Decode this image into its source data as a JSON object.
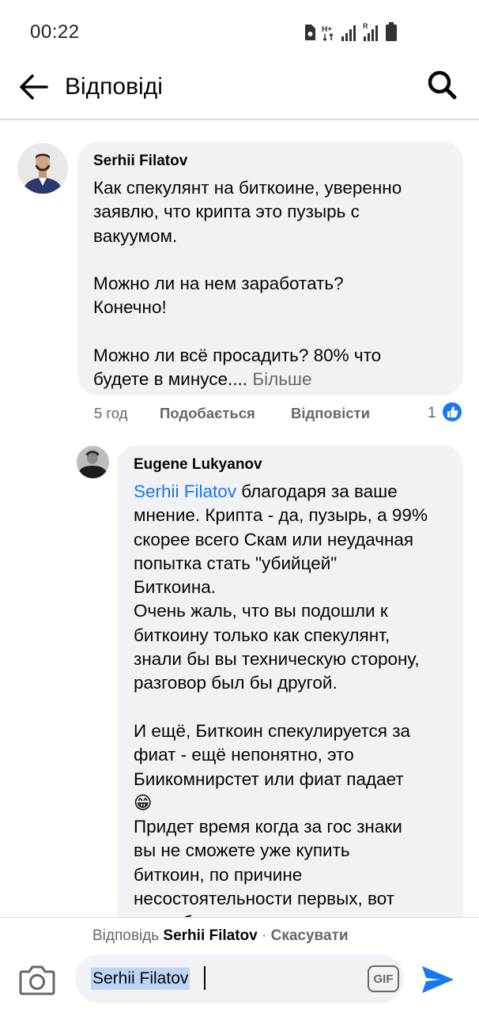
{
  "status_bar": {
    "time": "00:22",
    "icons": [
      "sim-card-icon",
      "network-h-plus-icon",
      "signal-icon",
      "signal-roaming-icon",
      "battery-icon"
    ]
  },
  "header": {
    "title": "Відповіді",
    "back_icon": "back-arrow-icon",
    "search_icon": "search-icon"
  },
  "parent_comment": {
    "author": "Serhii Filatov",
    "text": "Как спекулянт на биткоине, уверенно\nзаявлю, что крипта это пузырь с\nвакуумом.\n\nМожно ли на нем заработать?\nКонечно!\n\nМожно ли всё просадить? 80% что\nбудете в минусе....",
    "more_label": "Більше",
    "time": "5 год",
    "like_label": "Подобається",
    "reply_label": "Відповісти",
    "reaction_count": "1",
    "reaction_icon": "like-thumb-icon"
  },
  "reply_comment": {
    "author": "Eugene Lukyanov",
    "mention": "Serhii Filatov",
    "text_first_line": " благодаря за ваше",
    "text_rest": "мнение. Крипта - да, пузырь, а 99%\nскорее всего Скам или неудачная\nпопытка стать \"убийцей\"\nБиткоина.\nОчень жаль, что вы подошли к\nбиткоину только как спекулянт,\nзнали бы вы техническую сторону,\nразговор был бы другой.\n\nИ ещё, Биткоин спекулируется за\nфиат - ещё непонятно, это\nБиикомнирстет или фиат падает",
    "emoji": "😁",
    "text_after_emoji": "Придет время когда за гос знаки\nвы не сможете уже купить\nбиткоин, по причине\nнесостоятельности первых, вот\nтогда будет понятно, кто прав"
  },
  "reply_bar": {
    "replying_prefix": "Відповідь",
    "replying_to": "Serhii Filatov",
    "separator": "·",
    "cancel_label": "Скасувати",
    "input_value": "Serhii Filatov",
    "gif_label": "GIF",
    "camera_icon": "camera-icon",
    "send_icon": "send-icon"
  },
  "colors": {
    "accent": "#1877f2",
    "bubble": "#f0f2f5",
    "secondary_text": "#65676b",
    "mention_highlight": "#bcd5f7"
  }
}
